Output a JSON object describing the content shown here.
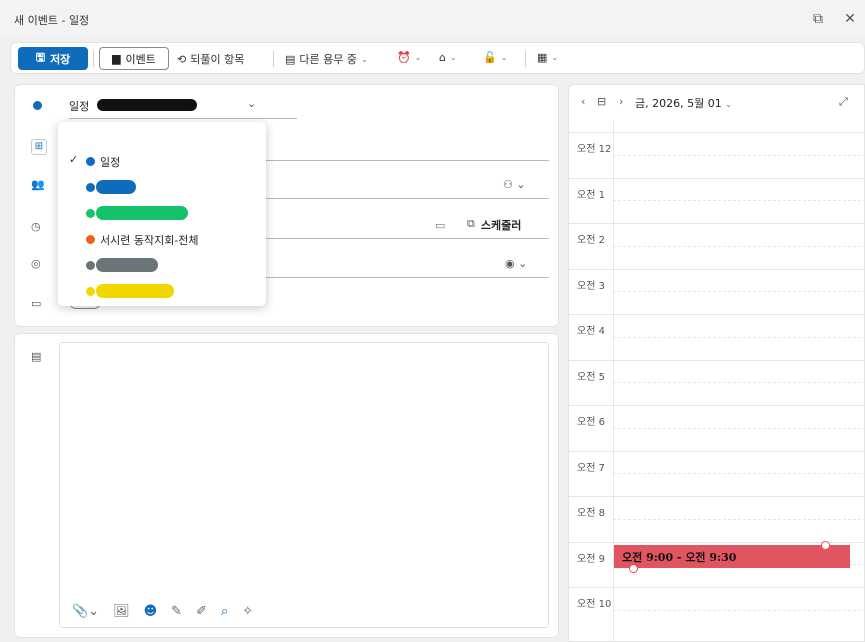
{
  "window": {
    "title": "새 이벤트 - 일정"
  },
  "toolbar": {
    "save_label": "저장",
    "event_label": "이벤트",
    "undo_label": "되풀이 항목",
    "busy_label": "다른 용무 중",
    "reminder_icon": "alarm-icon",
    "tag_icon": "tag-icon",
    "lock_icon": "lock-icon",
    "more_icon": "grid-icon"
  },
  "form": {
    "calendar_select": "일정",
    "scheduler_label": "스케줄러"
  },
  "dropdown": {
    "items": [
      {
        "label": "일정",
        "color": "#0f6cbd",
        "checked": true
      },
      {
        "label": "",
        "color": "#0f6cbd",
        "redacted": true
      },
      {
        "label": "",
        "color": "#13c26b",
        "redacted": true
      },
      {
        "label": "서시련 동작지회-전체",
        "color": "#e8631a"
      },
      {
        "label": "",
        "color": "#6b7479",
        "redacted": true
      },
      {
        "label": "",
        "color": "#f2d600",
        "redacted": true
      }
    ]
  },
  "calendar": {
    "date_label": "금, 2026, 5월 01",
    "hours": [
      "오전 12",
      "오전 1",
      "오전 2",
      "오전 3",
      "오전 4",
      "오전 5",
      "오전 6",
      "오전 7",
      "오전 8",
      "오전 9",
      "오전 10"
    ],
    "event_label": "오전 9:00 - 오전 9:30",
    "event_color": "#e0555f"
  }
}
